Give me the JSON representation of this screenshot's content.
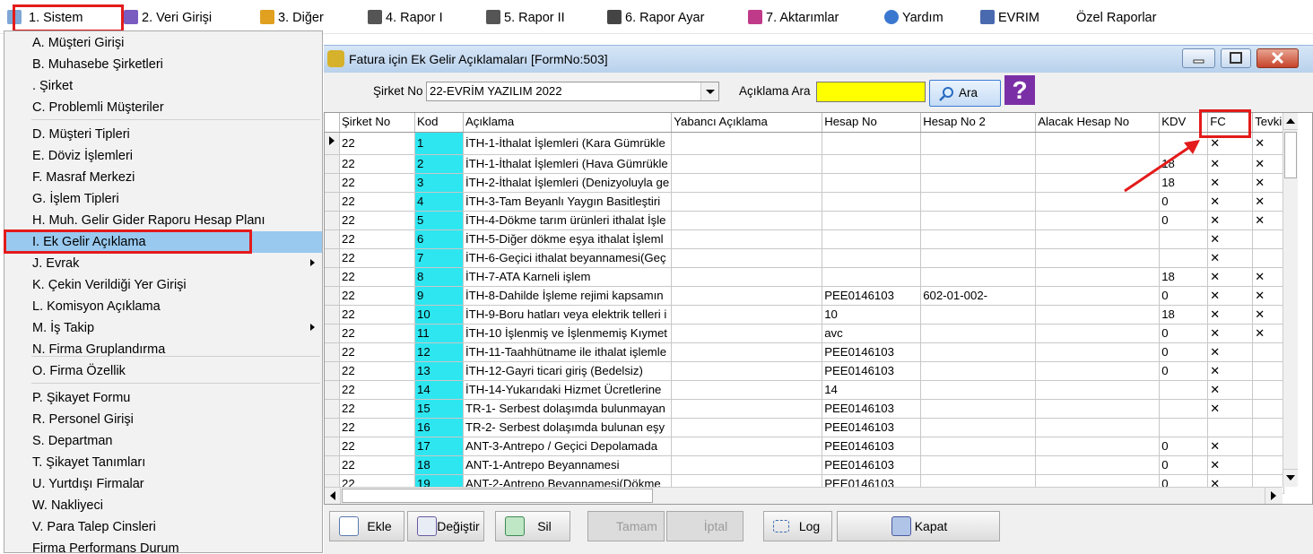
{
  "menubar": {
    "items": [
      "1.  Sistem",
      "2.  Veri Girişi",
      "3.  Diğer",
      "4.   Rapor I",
      "5.   Rapor II",
      "6.   Rapor Ayar",
      "7.   Aktarımlar",
      "Yardım",
      "EVRIM",
      "Özel Raporlar"
    ]
  },
  "dropdown": {
    "items": [
      "A.  Müşteri Girişi",
      "B.  Muhasebe Şirketleri",
      " .  Şirket",
      "C.  Problemli Müşteriler",
      "D.  Müşteri Tipleri",
      "E.  Döviz İşlemleri",
      "F.  Masraf Merkezi",
      "G.  İşlem Tipleri",
      "H.  Muh. Gelir Gider Raporu Hesap Planı",
      "I.  Ek Gelir Açıklama",
      "J.  Evrak",
      "K.  Çekin Verildiği Yer Girişi",
      "L.  Komisyon Açıklama",
      "M.  İş Takip",
      "N.  Firma Gruplandırma",
      "O.  Firma Özellik",
      "P.  Şikayet Formu",
      "R.  Personel Girişi",
      "S.  Departman",
      "T.  Şikayet Tanımları",
      "U.  Yurtdışı Firmalar",
      "W.  Nakliyeci",
      "V.  Para Talep Cinsleri",
      "Firma Performans Durum"
    ]
  },
  "window": {
    "title": "Fatura için Ek Gelir Açıklamaları [FormNo:503]"
  },
  "filter": {
    "sirket_label": "Şirket No",
    "sirket_value": "22-EVRİM YAZILIM  2022",
    "aciklama_label": "Açıklama Ara",
    "search_value": "",
    "ara_label": "Ara"
  },
  "grid": {
    "columns": [
      "Şirket No",
      "Kod",
      "Açıklama",
      "Yabancı Açıklama",
      "Hesap No",
      "Hesap No 2",
      "Alacak Hesap No",
      "KDV",
      "FC",
      "Tevki"
    ],
    "rows": [
      [
        "22",
        "1",
        "İTH-1-İthalat İşlemleri  (Kara Gümrükle",
        "",
        "",
        "",
        "",
        "",
        "✕",
        "✕"
      ],
      [
        "22",
        "2",
        "İTH-1-İthalat İşlemleri  (Hava Gümrükle",
        "",
        "",
        "",
        "",
        "18",
        "✕",
        "✕"
      ],
      [
        "22",
        "3",
        "İTH-2-İthalat İşlemleri (Denizyoluyla ge",
        "",
        "",
        "",
        "",
        "18",
        "✕",
        "✕"
      ],
      [
        "22",
        "4",
        "İTH-3-Tam Beyanlı Yaygın Basitleştiri",
        "",
        "",
        "",
        "",
        "0",
        "✕",
        "✕"
      ],
      [
        "22",
        "5",
        "İTH-4-Dökme tarım ürünleri ithalat İşle",
        "",
        "",
        "",
        "",
        "0",
        "✕",
        "✕"
      ],
      [
        "22",
        "6",
        "İTH-5-Diğer dökme eşya ithalat İşleml",
        "",
        "",
        "",
        "",
        "",
        "✕",
        ""
      ],
      [
        "22",
        "7",
        "İTH-6-Geçici ithalat beyannamesi(Geç",
        "",
        "",
        "",
        "",
        "",
        "✕",
        ""
      ],
      [
        "22",
        "8",
        "İTH-7-ATA Karneli işlem",
        "",
        "",
        "",
        "",
        "18",
        "✕",
        "✕"
      ],
      [
        "22",
        "9",
        "İTH-8-Dahilde İşleme rejimi kapsamın",
        "",
        "PEE0146103",
        "602-01-002-",
        "",
        "0",
        "✕",
        "✕"
      ],
      [
        "22",
        "10",
        "İTH-9-Boru hatları veya elektrik telleri i",
        "",
        "10",
        "",
        "",
        "18",
        "✕",
        "✕"
      ],
      [
        "22",
        "11",
        "İTH-10 İşlenmiş ve İşlenmemiş Kıymet",
        "",
        "avc",
        "",
        "",
        "0",
        "✕",
        "✕"
      ],
      [
        "22",
        "12",
        "İTH-11-Taahhütname ile ithalat işlemle",
        "",
        "PEE0146103",
        "",
        "",
        "0",
        "✕",
        ""
      ],
      [
        "22",
        "13",
        "İTH-12-Gayri ticari giriş (Bedelsiz)",
        "",
        "PEE0146103",
        "",
        "",
        "0",
        "✕",
        ""
      ],
      [
        "22",
        "14",
        "İTH-14-Yukarıdaki Hizmet Ücretlerine",
        "",
        "14",
        "",
        "",
        "",
        "✕",
        ""
      ],
      [
        "22",
        "15",
        "TR-1- Serbest dolaşımda bulunmayan",
        "",
        "PEE0146103",
        "",
        "",
        "",
        "✕",
        ""
      ],
      [
        "22",
        "16",
        "TR-2- Serbest dolaşımda bulunan eşy",
        "",
        "PEE0146103",
        "",
        "",
        "",
        "",
        ""
      ],
      [
        "22",
        "17",
        "ANT-3-Antrepo / Geçici Depolamada",
        "",
        "PEE0146103",
        "",
        "",
        "0",
        "✕",
        ""
      ],
      [
        "22",
        "18",
        "ANT-1-Antrepo Beyannamesi",
        "",
        "PEE0146103",
        "",
        "",
        "0",
        "✕",
        ""
      ],
      [
        "22",
        "19",
        "ANT-2-Antrepo Beyannamesi(Dökme",
        "",
        "PEE0146103",
        "",
        "",
        "0",
        "✕",
        ""
      ]
    ]
  },
  "buttons": {
    "ekle": "Ekle",
    "degistir": "Değiştir",
    "sil": "Sil",
    "tamam": "Tamam",
    "iptal": "İptal",
    "log": "Log",
    "kapat": "Kapat"
  },
  "colors": {
    "highlight_box": "#e31b1b",
    "kod_column": "#2ee6f0",
    "search_field": "#ffff00",
    "selected_menu": "#99c9ef"
  }
}
